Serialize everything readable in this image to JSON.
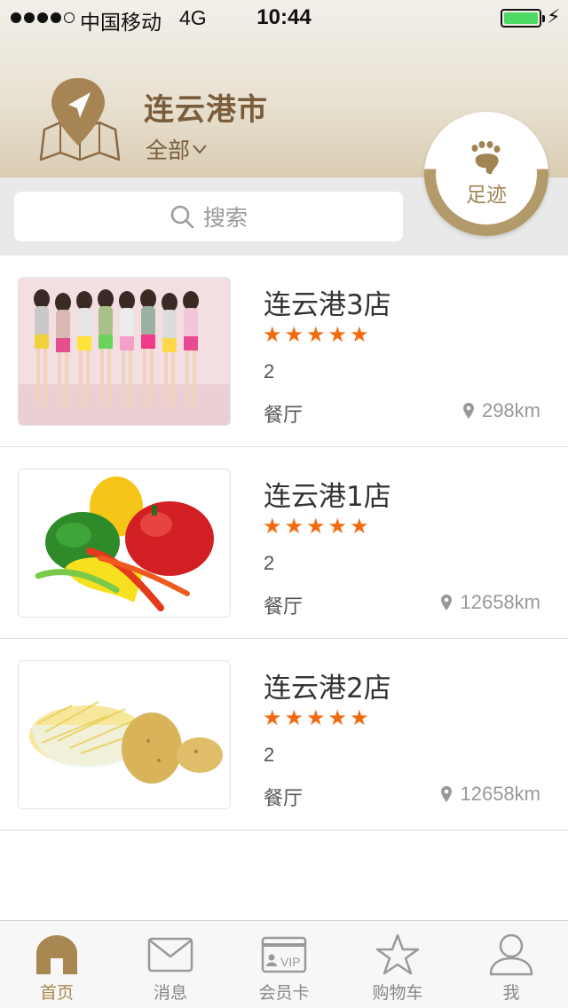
{
  "status_bar": {
    "carrier": "中国移动",
    "network": "4G",
    "time": "10:44"
  },
  "header": {
    "city": "连云港市",
    "area_filter": "全部"
  },
  "search": {
    "placeholder": "搜索"
  },
  "footprint": {
    "label": "足迹"
  },
  "stores": [
    {
      "name": "连云港3店",
      "rating": 5,
      "count": "2",
      "category": "餐厅",
      "distance": "298km",
      "image": "group-photo"
    },
    {
      "name": "连云港1店",
      "rating": 5,
      "count": "2",
      "category": "餐厅",
      "distance": "12658km",
      "image": "bell-peppers"
    },
    {
      "name": "连云港2店",
      "rating": 5,
      "count": "2",
      "category": "餐厅",
      "distance": "12658km",
      "image": "potatoes"
    }
  ],
  "tabs": [
    {
      "label": "首页",
      "icon": "home-icon",
      "active": true
    },
    {
      "label": "消息",
      "icon": "mail-icon",
      "active": false
    },
    {
      "label": "会员卡",
      "icon": "vip-card-icon",
      "active": false
    },
    {
      "label": "购物车",
      "icon": "star-icon",
      "active": false
    },
    {
      "label": "我",
      "icon": "user-icon",
      "active": false
    }
  ],
  "colors": {
    "accent": "#a88850",
    "star": "#f26a0e",
    "header_text": "#7a5c3a"
  }
}
